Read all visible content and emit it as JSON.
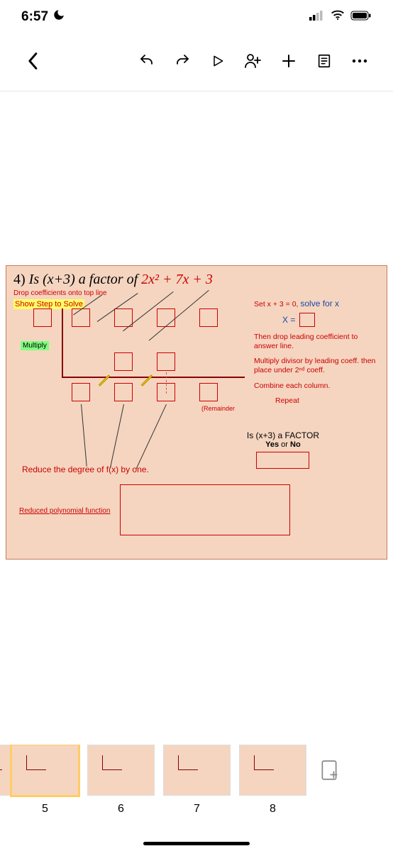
{
  "status": {
    "time": "6:57"
  },
  "worksheet": {
    "q_num": "4)",
    "q_text_a": "Is (x+3) a factor of ",
    "q_poly": "2x² + 7x + 3",
    "drop_coeff": "Drop coefficients onto top line",
    "show_step": "Show Step to Solve",
    "set_eq": "Set  x + 3 = 0, ",
    "solve": "solve for x",
    "x_eq": "X =",
    "instr1": "Then drop leading coefficient to answer line.",
    "instr2": "Multiply divisor by leading coeff. then place under 2ⁿᵈ coeff.",
    "instr3": "Combine each column.",
    "instr4": "Repeat",
    "multiply": "Multiply",
    "remainder": "(Remainder",
    "is_factor_q": "Is (x+3) a FACTOR",
    "yes_no": "Yes or No",
    "reduce": "Reduce the degree of f(x) by one.",
    "rpf": "Reduced polynomial function"
  },
  "thumbs": {
    "items": [
      {
        "n": ""
      },
      {
        "n": "5"
      },
      {
        "n": "6"
      },
      {
        "n": "7"
      },
      {
        "n": "8"
      }
    ]
  }
}
